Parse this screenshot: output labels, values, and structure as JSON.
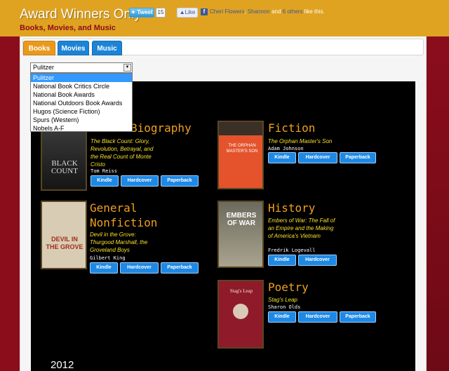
{
  "header": {
    "site_title": "Award Winners Only",
    "subtitle": "Books, Movies, and Music",
    "tweet_label": "Tweet",
    "tweet_count": "15",
    "like_label": "Like",
    "like_prefix": "Cheri Flowers",
    "like_mid": "Shannon",
    "like_and": "and",
    "like_others": "6 others",
    "like_suffix": "like this."
  },
  "tabs": [
    {
      "label": "Books",
      "active": true
    },
    {
      "label": "Movies",
      "active": false
    },
    {
      "label": "Music",
      "active": false
    }
  ],
  "award_select": {
    "selected": "Pulitzer",
    "options": [
      "Pulitzer",
      "National Book Critics Circle",
      "National Book Awards",
      "National Outdoors Book Awards",
      "Hugos (Science Fiction)",
      "Spurs (Western)",
      "Nobels A-F"
    ]
  },
  "buy_buttons": {
    "kindle": "Kindle",
    "hardcover": "Hardcover",
    "paperback": "Paperback"
  },
  "books": [
    {
      "category": "Biography",
      "title": "The Black Count: Glory, Revolution, Betrayal, and the Real Count of Monte Cristo",
      "author": "Tom Reiss",
      "cover_text": "BLACK COUNT",
      "cover_color": "#2a2a2a"
    },
    {
      "category": "Fiction",
      "title": "The Orphan Master's Son",
      "author": "Adam Johnson",
      "cover_text": "THE ORPHAN MASTER'S SON",
      "cover_color": "#e4532c"
    },
    {
      "category": "General Nonfiction",
      "category_line1": "General",
      "category_line2": "Nonfiction",
      "title": "Devil in the Grove: Thurgood Marshall, the Groveland Boys",
      "author": "Gilbert King",
      "cover_text": "DEVIL IN THE GROVE",
      "cover_color": "#d8cdb4"
    },
    {
      "category": "History",
      "title": "Embers of War: The Fall of an Empire and the Making of America's Vietnam",
      "author": "Fredrik Logevall",
      "cover_text": "EMBERS OF WAR",
      "cover_color": "#8c8a7c"
    },
    {
      "category": "Poetry",
      "title": "Stag's Leap",
      "author": "Sharon Olds",
      "cover_text": "Stag's Leap",
      "cover_color": "#8e1a2a"
    }
  ],
  "year_heading": "2012",
  "colors": {
    "header_bg": "#e0a321",
    "page_bg": "#8b0d1c",
    "tab_active": "#e99a1d",
    "tab_inactive": "#1c84d6",
    "category_color": "#f0a020",
    "title_color": "#f7e02a",
    "button_color": "#1e88e5"
  }
}
